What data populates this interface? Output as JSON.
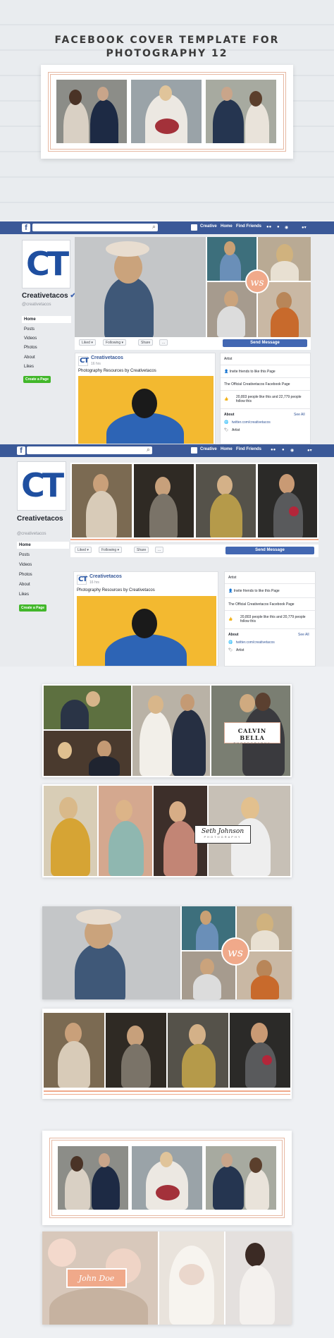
{
  "hero": {
    "title_line1": "FACEBOOK COVER TEMPLATE FOR",
    "title_line2": "PHOTOGRAPHY 12"
  },
  "facebook": {
    "logo": "f",
    "nav_name": "Creative",
    "nav_home": "Home",
    "nav_find_friends": "Find Friends",
    "page_name": "Creativetacos",
    "handle": "@creativetacos",
    "sidebar": [
      "Home",
      "Posts",
      "Videos",
      "Photos",
      "About",
      "Likes"
    ],
    "create_page": "Create a Page",
    "liked": "Liked",
    "following": "Following",
    "share": "Share",
    "more": "...",
    "send_message": "Send Message",
    "post_author": "Creativetacos",
    "post_time": "16 hrs",
    "post_text": "Photography Resources by Creativetacos",
    "artist": "Artist",
    "invite": "Invite friends to like this Page",
    "official": "The Official Creativetacos Facebook Page",
    "likes_mock1": "20,803 people like this and 22,779 people follow this",
    "likes_mock2": "20,803 people like this and 20,779 people follow this",
    "about": "About",
    "see_all": "See All",
    "link": "twitter.com/creativetacos",
    "logo_text": "CT",
    "monogram": "ws"
  },
  "templates": {
    "calvin_name": "CALVIN BELLA",
    "calvin_sub": "PHOTOGRAPHY",
    "seth_name": "Seth Johnson",
    "seth_sub": "PHOTOGRAPHY",
    "monogram": "ws",
    "john_name": "John Doe"
  },
  "colors": {
    "fb_blue": "#3b5998",
    "accent_peach": "#f0a98a",
    "logo_blue": "#1f4fa0"
  }
}
